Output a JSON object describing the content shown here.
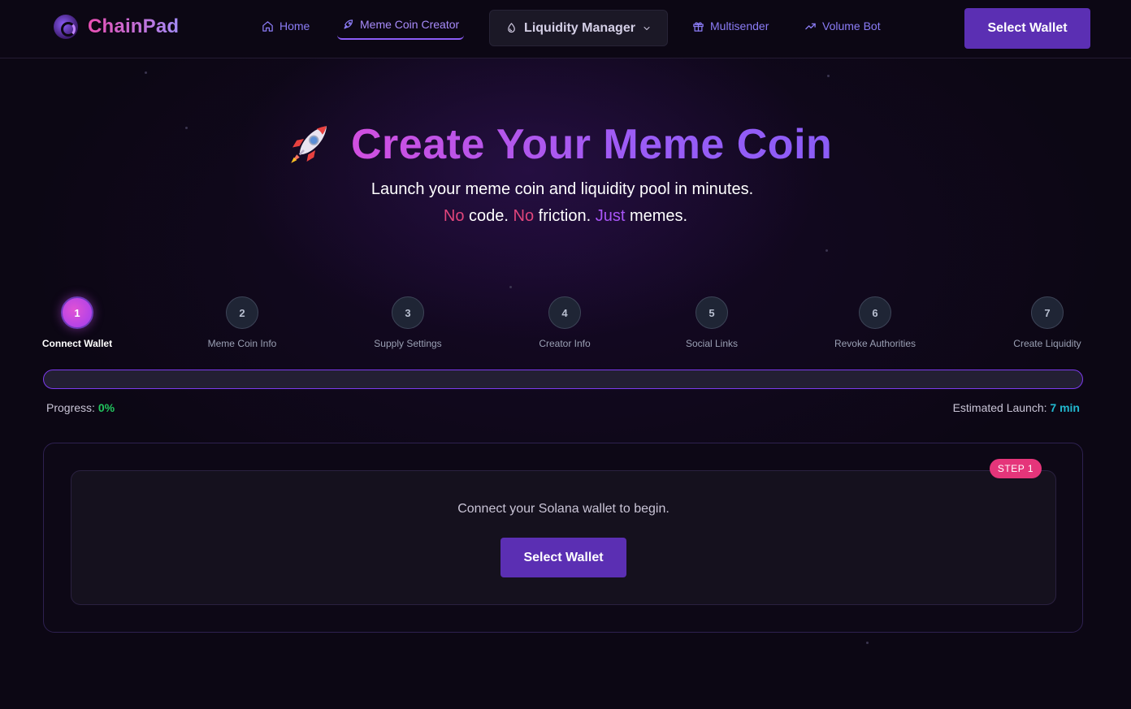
{
  "header": {
    "logo_text": "ChainPad",
    "nav": [
      {
        "label": "Home",
        "icon": "home-icon"
      },
      {
        "label": "Meme Coin Creator",
        "icon": "rocket-icon",
        "active": true
      },
      {
        "label": "Liquidity Manager",
        "icon": "droplet-icon",
        "dropdown": true
      },
      {
        "label": "Multisender",
        "icon": "gift-icon"
      },
      {
        "label": "Volume Bot",
        "icon": "trending-up-icon"
      }
    ],
    "wallet_button": "Select Wallet"
  },
  "hero": {
    "title": "Create Your Meme Coin",
    "subtitle": "Launch your meme coin and liquidity pool in minutes.",
    "tagline": {
      "w1": "No",
      "t1": " code. ",
      "w2": "No",
      "t2": " friction. ",
      "w3": "Just",
      "t3": " memes."
    }
  },
  "steps": [
    {
      "number": "1",
      "label": "Connect Wallet",
      "active": true
    },
    {
      "number": "2",
      "label": "Meme Coin Info"
    },
    {
      "number": "3",
      "label": "Supply Settings"
    },
    {
      "number": "4",
      "label": "Creator Info"
    },
    {
      "number": "5",
      "label": "Social Links"
    },
    {
      "number": "6",
      "label": "Revoke Authorities"
    },
    {
      "number": "7",
      "label": "Create Liquidity"
    }
  ],
  "progress": {
    "label": "Progress:",
    "value": "0%",
    "fraction": 0,
    "eta_label": "Estimated Launch:",
    "eta_value": "7 min"
  },
  "card": {
    "badge": "STEP 1",
    "message": "Connect your Solana wallet to begin.",
    "button": "Select Wallet"
  },
  "colors": {
    "accent": "#5b2fb3",
    "gradient_start": "#d14fe0",
    "gradient_end": "#8b5cf6",
    "badge": "#e5357a",
    "progress_value": "#22c55e",
    "eta_value": "#22b8cf"
  }
}
